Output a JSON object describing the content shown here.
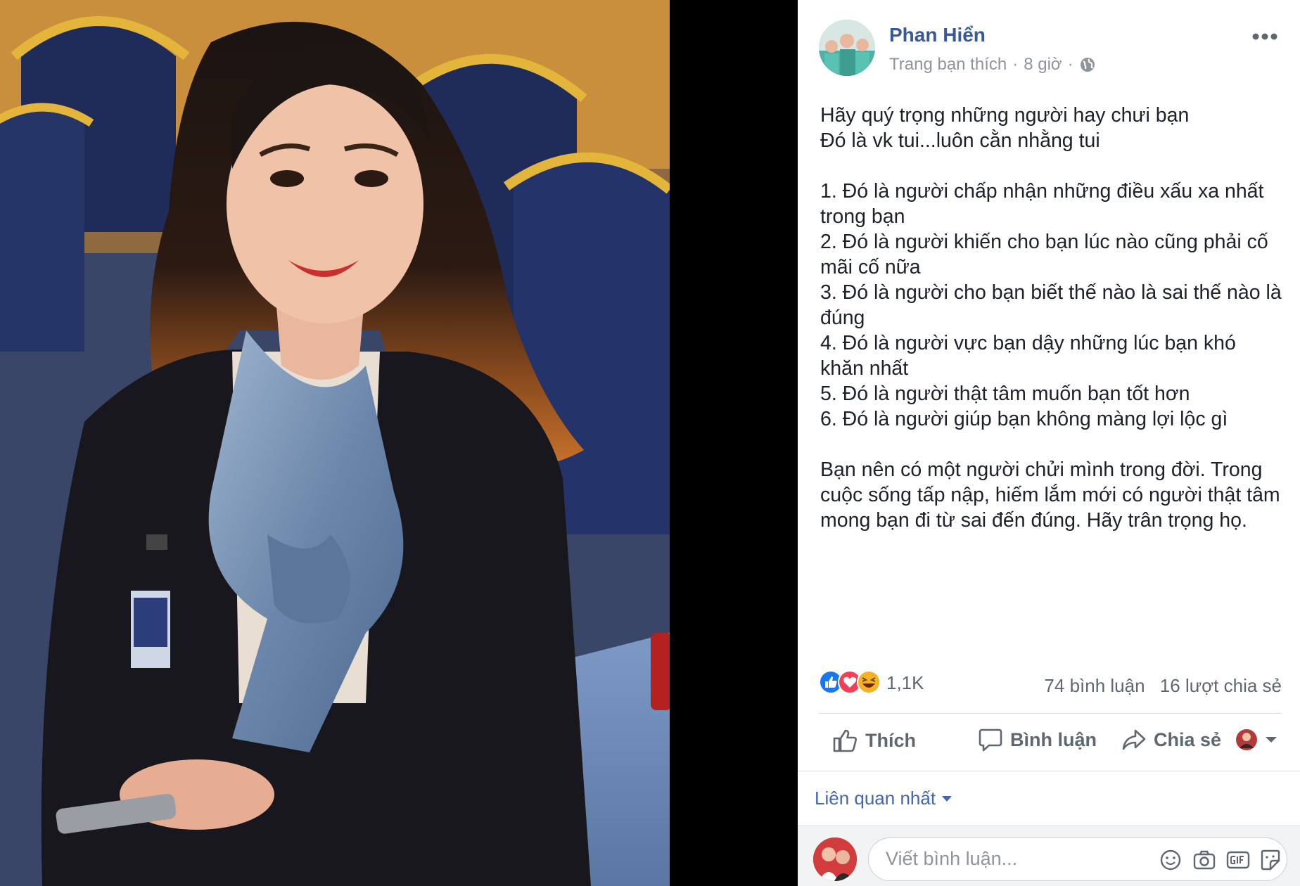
{
  "post": {
    "author": "Phan Hiển",
    "source": "Trang bạn thích",
    "time": "8 giờ",
    "separator": "·",
    "text": "Hãy quý trọng những người hay chưi bạn\nĐó là vk tui...luôn cằn nhằng tui\n\n1. Đó là người chấp nhận những điều xấu xa nhất trong bạn\n2. Đó là người khiến cho bạn lúc nào cũng phải cố mãi cố nữa\n3. Đó là người cho bạn biết thế nào là sai thế nào là đúng\n4. Đó là người vực bạn dậy những lúc bạn khó khăn nhất\n5. Đó là người thật tâm muốn bạn tốt hơn\n6. Đó là người giúp bạn không màng lợi lộc gì\n\nBạn nên có một người chửi mình trong đời. Trong cuộc sống tấp nập, hiếm lắm mới có người thật tâm mong bạn đi từ sai đến đúng. Hãy trân trọng họ."
  },
  "stats": {
    "reactions_count": "1,1K",
    "comments": "74 bình luận",
    "shares": "16 lượt chia sẻ",
    "reaction_icons": [
      "like-icon",
      "love-icon",
      "haha-icon"
    ]
  },
  "actions": {
    "like": "Thích",
    "comment": "Bình luận",
    "share": "Chia sẻ"
  },
  "comments": {
    "sort_label": "Liên quan nhất",
    "placeholder": "Viết bình luận...",
    "box_icons": [
      "emoji-icon",
      "camera-icon",
      "gif-icon",
      "sticker-icon"
    ]
  },
  "colors": {
    "author": "#385898",
    "link": "#4267b2",
    "muted": "#90949c",
    "like_blue": "#1877f2",
    "love_red": "#f33e58",
    "haha_yellow": "#f7b125"
  }
}
